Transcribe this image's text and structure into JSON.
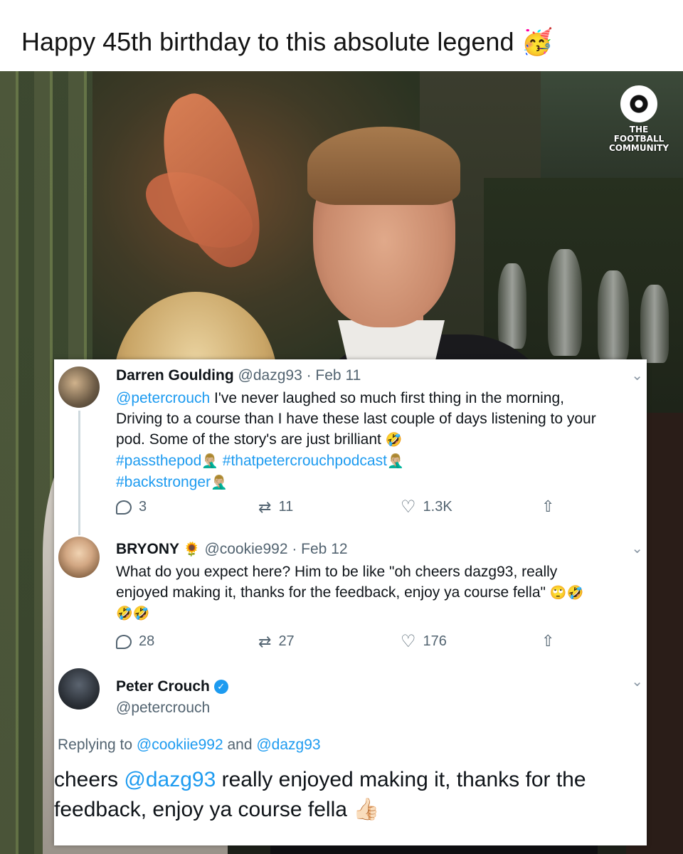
{
  "caption": {
    "text": "Happy 45th birthday to this absolute legend",
    "emoji": "🥳"
  },
  "logo": {
    "line1": "THE FOOTBALL",
    "line2": "COMMUNITY"
  },
  "tweets": [
    {
      "name": "Darren Goulding",
      "handle": "@dazg93",
      "date": "· Feb 11",
      "mention": "@petercrouch",
      "line1_rest": " I've never laughed so much first thing in the morning,",
      "line2": "Driving to a course than I have these last couple of days listening to your",
      "line3": "pod. Some of the story's are just brilliant",
      "line3_emoji": "🤣",
      "hashtag1": "#passthepod",
      "hashtag1_emoji": "🤦🏼‍♂️",
      "hashtag2": "#thatpetercrouchpodcast",
      "hashtag2_emoji": "🤦🏼‍♂️",
      "hashtag3": "#backstronger",
      "hashtag3_emoji": "🤦🏼‍♂️",
      "replies": "3",
      "retweets": "11",
      "likes": "1.3K"
    },
    {
      "name": "BRYONY",
      "name_emoji": "🌻",
      "handle": "@cookie992",
      "date": "· Feb 12",
      "line1": "What do you expect here? Him to be like \"oh cheers dazg93, really",
      "line2": "enjoyed making it, thanks for the feedback, enjoy ya course fella\"",
      "line2_emoji": "🙄🤣",
      "line3_emoji": "🤣🤣",
      "replies": "28",
      "retweets": "27",
      "likes": "176"
    },
    {
      "name": "Peter Crouch",
      "verified_mark": "✓",
      "handle": "@petercrouch",
      "replying_prefix": "Replying to ",
      "replying_to1": "@cookiie992",
      "replying_and": " and ",
      "replying_to2": "@dazg93",
      "body1_start": "cheers ",
      "body1_mention": "@dazg93",
      "body1_rest": " really enjoyed making it, thanks for the",
      "body2": "feedback, enjoy ya course fella",
      "body2_emoji": "👍🏻"
    }
  ],
  "icons": {
    "reply": "reply-icon",
    "retweet": "retweet-icon",
    "like": "heart-icon",
    "share": "share-icon",
    "chevron": "chevron-down-icon"
  }
}
